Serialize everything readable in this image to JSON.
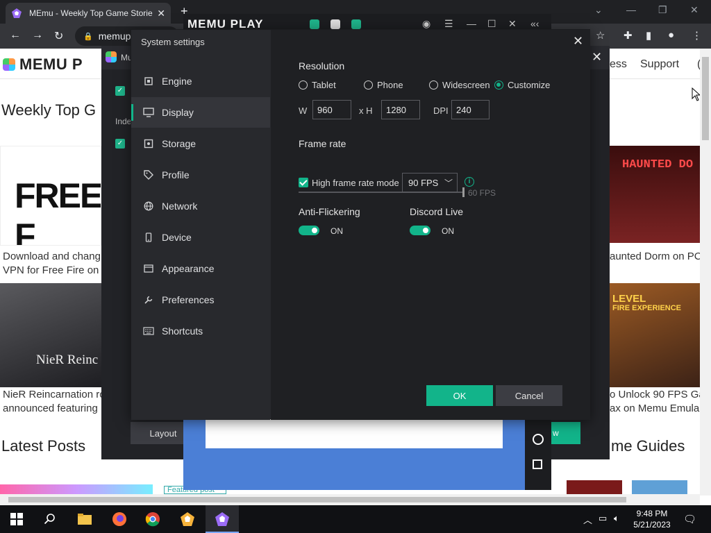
{
  "browser": {
    "tab_title": "MEmu - Weekly Top Game Stories",
    "address": "memup",
    "new_tab": "+"
  },
  "site": {
    "logo": "MEMU P",
    "nav_partial": "ess",
    "nav_support": "Support",
    "nav_cut": "(",
    "weekly_heading": "Weekly Top G",
    "latest_heading": "Latest Posts",
    "guides_heading": "me Guides",
    "cards": [
      {
        "line1": "Download and chang",
        "line2": "VPN for Free Fire on"
      },
      {
        "line1": "NieR Reincarnation ro",
        "line2": "announced featuring"
      },
      {
        "line1": "aunted Dorm on PC",
        "line2": ""
      },
      {
        "line1": "o Unlock 90 FPS Ga",
        "line2": "ax on Memu Emula"
      }
    ],
    "img_freefire": "FREE F",
    "img_nier": "NieR Reinc",
    "img_haunted": "HAUNTED DO",
    "img_level_l1": "LEVEL",
    "img_level_l2": "FIRE EXPERIENCE",
    "featured": "Featured post"
  },
  "memu": {
    "brand": "MEMU PLAY",
    "multi_title": "Mu",
    "index_label": "Inde",
    "layout_btn": "Layout",
    "green_btn": "w"
  },
  "dialog": {
    "title": "System settings",
    "sidebar": [
      {
        "label": "Engine",
        "icon": "chip-icon"
      },
      {
        "label": "Display",
        "icon": "monitor-icon"
      },
      {
        "label": "Storage",
        "icon": "storage-icon"
      },
      {
        "label": "Profile",
        "icon": "tag-icon"
      },
      {
        "label": "Network",
        "icon": "globe-icon"
      },
      {
        "label": "Device",
        "icon": "phone-icon"
      },
      {
        "label": "Appearance",
        "icon": "window-icon"
      },
      {
        "label": "Preferences",
        "icon": "wrench-icon"
      },
      {
        "label": "Shortcuts",
        "icon": "keyboard-icon"
      }
    ],
    "active_item": "Display",
    "resolution": {
      "label": "Resolution",
      "options": [
        "Tablet",
        "Phone",
        "Widescreen",
        "Customize"
      ],
      "selected": "Customize",
      "w_label": "W",
      "w_value": "960",
      "h_label": "x H",
      "h_value": "1280",
      "dpi_label": "DPI",
      "dpi_value": "240"
    },
    "frame_rate": {
      "label": "Frame rate",
      "slider_value": "60 FPS",
      "high_mode_label": "High frame rate mode",
      "high_mode_checked": true,
      "select_value": "90 FPS",
      "info": "i"
    },
    "anti_flicker": {
      "label": "Anti-Flickering",
      "state": "ON"
    },
    "discord": {
      "label": "Discord Live",
      "state": "ON"
    },
    "ok": "OK",
    "cancel": "Cancel"
  },
  "taskbar": {
    "time": "9:48 PM",
    "date": "5/21/2023"
  },
  "colors": {
    "accent": "#12b48a",
    "dialog_bg": "#28292d",
    "main_bg": "#1f2023"
  }
}
